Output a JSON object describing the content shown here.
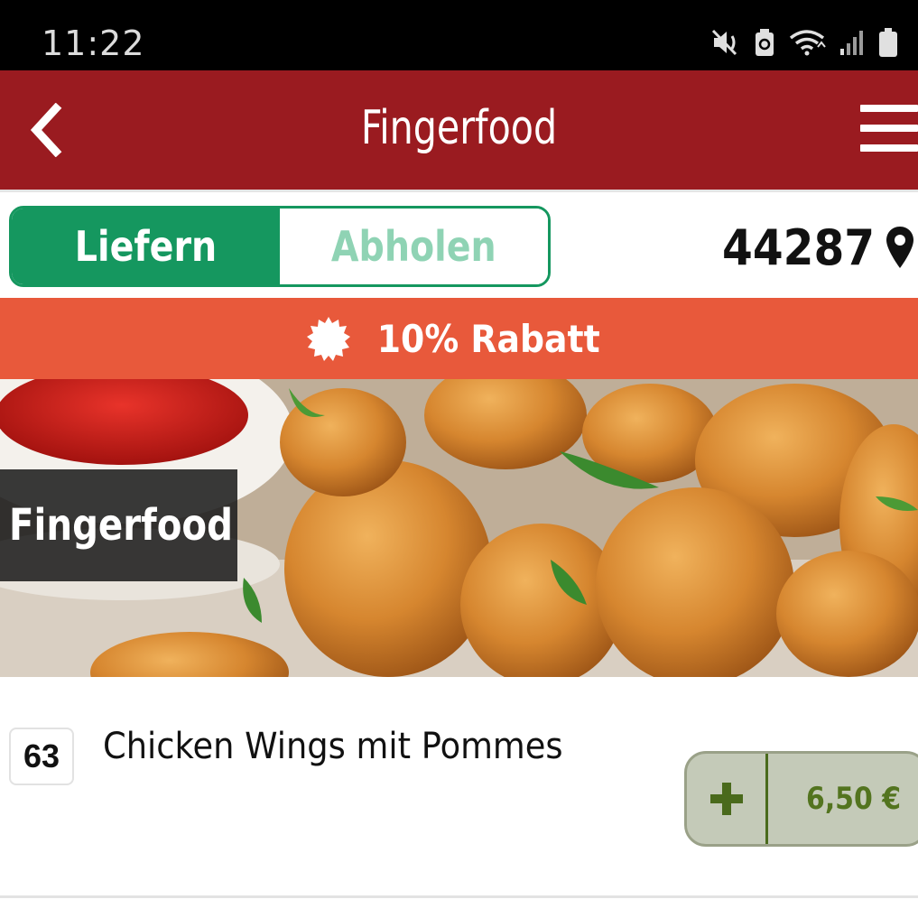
{
  "status_bar": {
    "time": "11:22",
    "icons": [
      "mute-icon",
      "battery-saver-icon",
      "wifi-icon",
      "signal-icon",
      "battery-icon"
    ]
  },
  "header": {
    "title": "Fingerfood",
    "back_icon": "chevron-left-icon",
    "menu_icon": "hamburger-menu-icon",
    "background": "#9a1b20"
  },
  "order_mode": {
    "options": [
      {
        "label": "Liefern",
        "active": true
      },
      {
        "label": "Abholen",
        "active": false
      }
    ],
    "accent": "#15975f",
    "zip_code": "44287",
    "location_icon": "map-pin-icon"
  },
  "discount": {
    "text": "10% Rabatt",
    "icon": "badge-icon",
    "background": "#e8593b"
  },
  "category": {
    "title": "Fingerfood"
  },
  "products": [
    {
      "number": "63",
      "name": "Chicken Wings mit Pommes",
      "price": "6,50 €",
      "add_icon": "plus-icon"
    }
  ]
}
